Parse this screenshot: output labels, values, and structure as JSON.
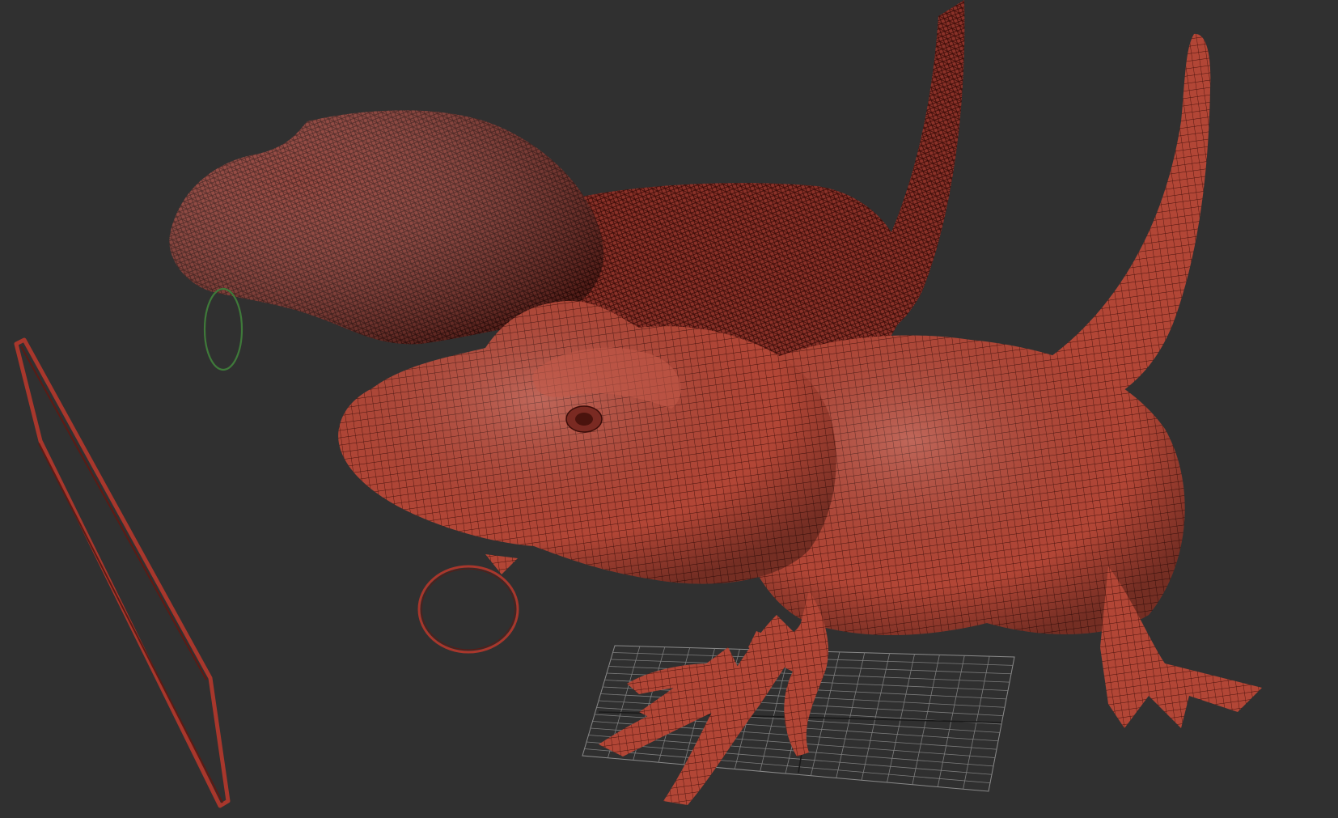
{
  "viewport": {
    "background": "#303030"
  },
  "colors": {
    "mesh_dark": "#7a2a22",
    "mesh_light": "#b94a3c",
    "mesh_highlight": "#d86a5a",
    "wire": "#3a0c08",
    "grid": "#8a8a8a",
    "grid_axis": "#1a1a1a",
    "helper_green": "#3f7a3a",
    "helper_red": "#a8372c"
  },
  "scene": {
    "objects": [
      {
        "name": "dense-trex-sculpt",
        "kind": "mesh"
      },
      {
        "name": "cartoon-trex-retopo",
        "kind": "mesh"
      },
      {
        "name": "ground-grid",
        "kind": "grid"
      },
      {
        "name": "circle-helper-green",
        "kind": "spline"
      },
      {
        "name": "circle-helper-red",
        "kind": "spline"
      },
      {
        "name": "plane-helper",
        "kind": "spline"
      }
    ]
  }
}
